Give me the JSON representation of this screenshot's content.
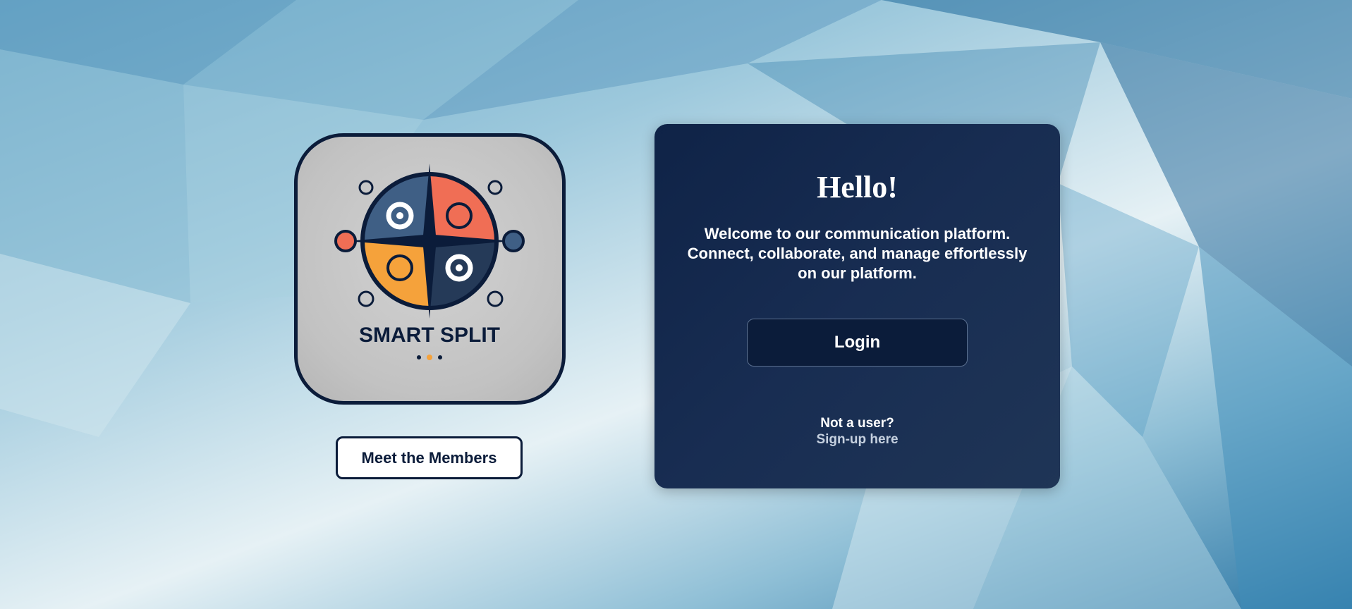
{
  "logo": {
    "text": "SMART SPLIT"
  },
  "members_button": {
    "label": "Meet the Members"
  },
  "panel": {
    "title": "Hello!",
    "welcome_text": "Welcome to our communication platform. Connect, collaborate, and manage effortlessly on our platform.",
    "login_label": "Login",
    "not_user_text": "Not a user?",
    "signup_link": "Sign-up here"
  },
  "colors": {
    "navy": "#0b1c3a",
    "panel": "#172b50",
    "accent_orange": "#f5a23b",
    "accent_coral": "#f06e55",
    "accent_slate": "#3f5f85"
  }
}
